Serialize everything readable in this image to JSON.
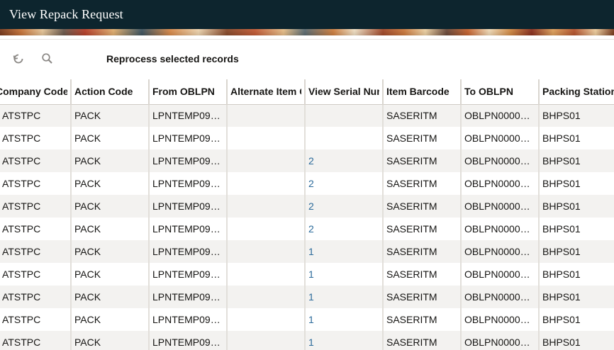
{
  "window": {
    "title": "View Repack Request"
  },
  "toolbar": {
    "refresh_icon": "refresh-icon",
    "search_icon": "search-icon",
    "reprocess_label": "Reprocess selected records"
  },
  "colors": {
    "titlebar": "#0d252e",
    "link": "#2b6a9a",
    "row_alt": "#f3f2f0"
  },
  "table": {
    "columns": [
      "Company Code",
      "Action Code",
      "From OBLPN",
      "Alternate Item Code",
      "View Serial Numbers",
      "Item Barcode",
      "To OBLPN",
      "Packing Station"
    ],
    "rows": [
      [
        "ATSTPC",
        "PACK",
        "LPNTEMP09…",
        "",
        "",
        "SASERITM",
        "OBLPN0000…",
        "BHPS01"
      ],
      [
        "ATSTPC",
        "PACK",
        "LPNTEMP09…",
        "",
        "",
        "SASERITM",
        "OBLPN0000…",
        "BHPS01"
      ],
      [
        "ATSTPC",
        "PACK",
        "LPNTEMP09…",
        "",
        "2",
        "SASERITM",
        "OBLPN0000…",
        "BHPS01"
      ],
      [
        "ATSTPC",
        "PACK",
        "LPNTEMP09…",
        "",
        "2",
        "SASERITM",
        "OBLPN0000…",
        "BHPS01"
      ],
      [
        "ATSTPC",
        "PACK",
        "LPNTEMP09…",
        "",
        "2",
        "SASERITM",
        "OBLPN0000…",
        "BHPS01"
      ],
      [
        "ATSTPC",
        "PACK",
        "LPNTEMP09…",
        "",
        "2",
        "SASERITM",
        "OBLPN0000…",
        "BHPS01"
      ],
      [
        "ATSTPC",
        "PACK",
        "LPNTEMP09…",
        "",
        "1",
        "SASERITM",
        "OBLPN0000…",
        "BHPS01"
      ],
      [
        "ATSTPC",
        "PACK",
        "LPNTEMP09…",
        "",
        "1",
        "SASERITM",
        "OBLPN0000…",
        "BHPS01"
      ],
      [
        "ATSTPC",
        "PACK",
        "LPNTEMP09…",
        "",
        "1",
        "SASERITM",
        "OBLPN0000…",
        "BHPS01"
      ],
      [
        "ATSTPC",
        "PACK",
        "LPNTEMP09…",
        "",
        "1",
        "SASERITM",
        "OBLPN0000…",
        "BHPS01"
      ],
      [
        "ATSTPC",
        "PACK",
        "LPNTEMP09…",
        "",
        "1",
        "SASERITM",
        "OBLPN0000…",
        "BHPS01"
      ]
    ]
  }
}
